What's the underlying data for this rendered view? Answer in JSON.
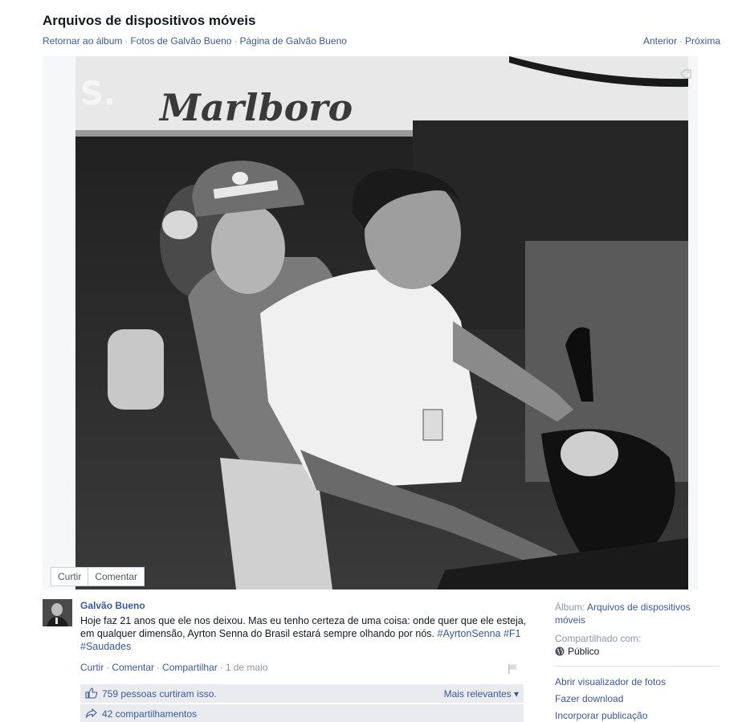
{
  "header": {
    "title": "Arquivos de dispositivos móveis",
    "nav_left": [
      "Retornar ao álbum",
      "Fotos de Galvão Bueno",
      "Página de Galvão Bueno"
    ],
    "nav_right": [
      "Anterior",
      "Próxima"
    ],
    "separator": "·"
  },
  "photo": {
    "sign_text": "Marlboro",
    "actions": [
      "Curtir",
      "Comentar"
    ]
  },
  "post": {
    "author": "Galvão Bueno",
    "text": "Hoje faz 21 anos que ele nos deixou. Mas eu tenho certeza de uma coisa: onde quer que ele esteja, em qualquer dimensão, Ayrton Senna do Brasil estará sempre olhando por nós.",
    "hashtags": "#AyrtonSenna #F1 #Saudades",
    "actions": [
      "Curtir",
      "Comentar",
      "Compartilhar"
    ],
    "date": "1 de maio",
    "likes_text": "759 pessoas curtiram isso.",
    "sort_label": "Mais relevantes ▾",
    "shares_text": "42 compartilhamentos"
  },
  "sidebar": {
    "album_label": "Álbum:",
    "album_name": "Arquivos de dispositivos móveis",
    "shared_label": "Compartilhado com:",
    "privacy": "Público",
    "actions": [
      "Abrir visualizador de fotos",
      "Fazer download",
      "Incorporar publicação"
    ]
  },
  "colors": {
    "link": "#3b5998",
    "muted": "#9197a3",
    "bar_bg": "#e9ebee"
  }
}
